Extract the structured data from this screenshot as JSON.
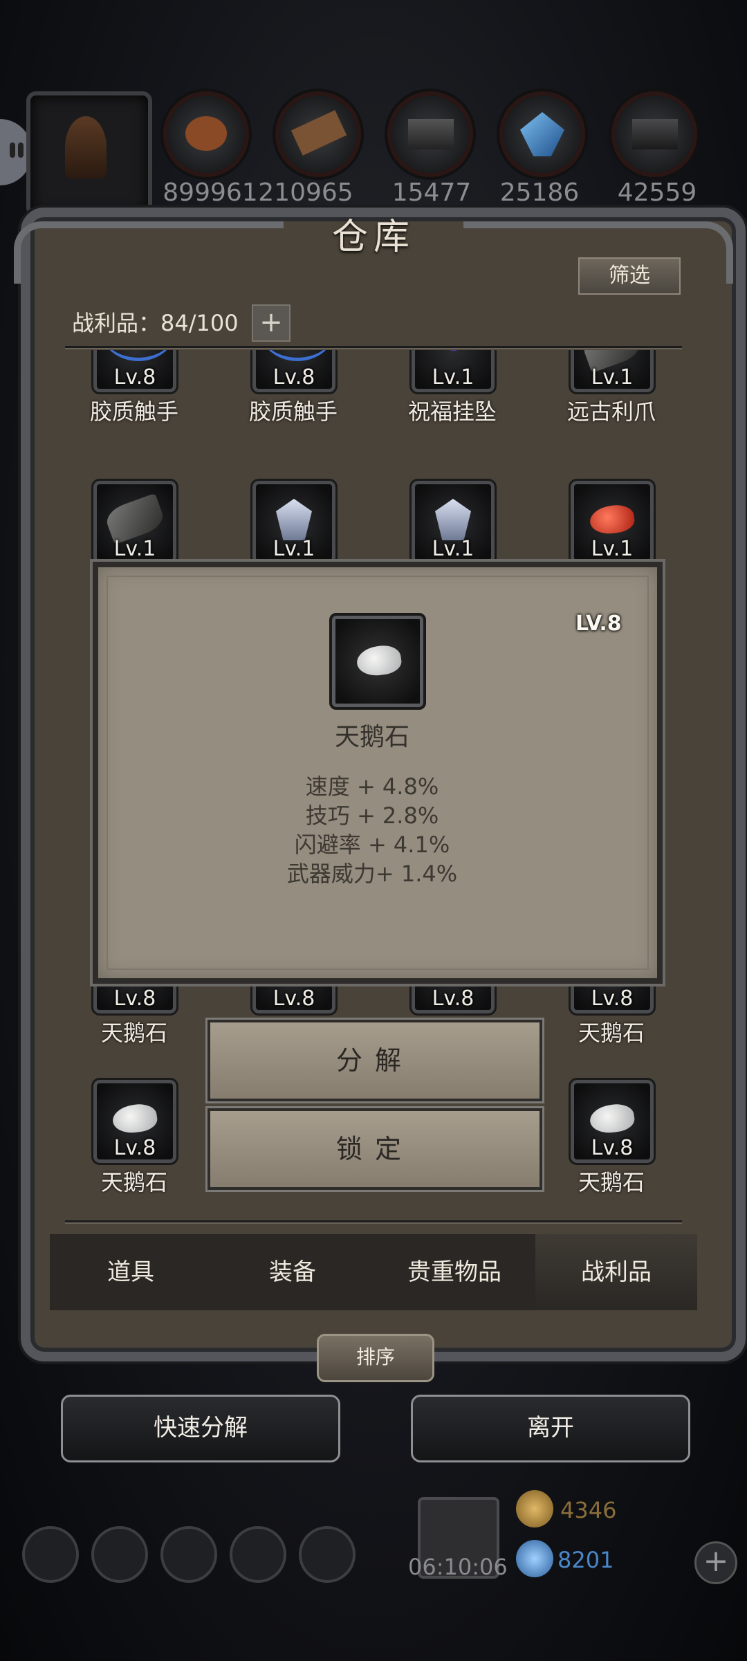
{
  "resources": [
    {
      "icon": "hooded-hero-portrait",
      "count": ""
    },
    {
      "icon": "meat-icon",
      "count": "899961"
    },
    {
      "icon": "wood-icon",
      "count": "210965"
    },
    {
      "icon": "iron-icon",
      "count": "15477"
    },
    {
      "icon": "crystal-icon",
      "count": "25186"
    },
    {
      "icon": "ore-icon",
      "count": "42559"
    }
  ],
  "warehouse": {
    "title": "仓库",
    "filter_label": "筛选",
    "capacity_label": "战利品：84/100",
    "plus": "+"
  },
  "grid": {
    "row1": [
      {
        "lv": "Lv.8",
        "name": "胶质触手",
        "icon": "tentacle"
      },
      {
        "lv": "Lv.8",
        "name": "胶质触手",
        "icon": "tentacle"
      },
      {
        "lv": "Lv.1",
        "name": "祝福挂坠",
        "icon": "pendant"
      },
      {
        "lv": "Lv.1",
        "name": "远古利爪",
        "icon": "claw"
      }
    ],
    "row2": [
      {
        "lv": "Lv.1",
        "icon": "claw"
      },
      {
        "lv": "Lv.1",
        "icon": "badge"
      },
      {
        "lv": "Lv.1",
        "icon": "badge"
      },
      {
        "lv": "Lv.1",
        "icon": "red-stone"
      }
    ],
    "row3": [
      {
        "lv": "Lv.8",
        "name": "天鹅石"
      },
      {
        "lv": "Lv.8"
      },
      {
        "lv": "Lv.8"
      },
      {
        "lv": "Lv.8",
        "name": "天鹅石"
      }
    ],
    "row4": [
      {
        "lv": "Lv.8",
        "name": "天鹅石"
      },
      {
        "lv": "Lv.8",
        "name": "天鹅石"
      }
    ]
  },
  "popup": {
    "level": "LV.8",
    "name": "天鹅石",
    "stats": [
      "速度 + 4.8%",
      "技巧 + 2.8%",
      "闪避率 + 4.1%",
      "武器威力+ 1.4%"
    ]
  },
  "actions": {
    "decompose": "分解",
    "lock": "锁定"
  },
  "tabs": [
    "道具",
    "装备",
    "贵重物品",
    "战利品"
  ],
  "active_tab": "战利品",
  "sort_label": "排序",
  "bottom": {
    "quick_decompose": "快速分解",
    "leave": "离开"
  },
  "footer": {
    "timer": "06:10:06",
    "gold": "4346",
    "gems": "8201",
    "gold_color": "#9a7a3a",
    "gem_color": "#4a86c8"
  }
}
